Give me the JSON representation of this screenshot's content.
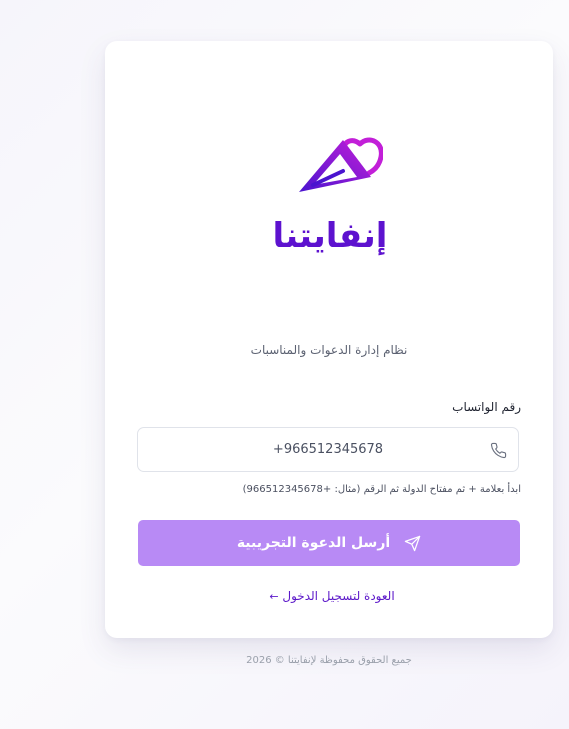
{
  "brand": {
    "logo_icon": "paper-plane-heart-icon",
    "name": "إنفايتنا",
    "primary_color": "#5d12cf",
    "accent_color": "#c026d3"
  },
  "subtitle": "نظام إدارة الدعوات والمناسبات",
  "phone": {
    "label": "رقم الواتساب",
    "value": "+966512345678",
    "icon": "phone-icon",
    "hint": "ابدأ بعلامة + ثم مفتاح الدولة ثم الرقم (مثال: +966512345678)"
  },
  "submit": {
    "label": "أرسل الدعوة التجريبية",
    "icon": "send-icon",
    "color": "#b88af5"
  },
  "back_link": {
    "label": "العودة لتسجيل الدخول",
    "icon": "arrow-left-icon",
    "arrow": "←"
  },
  "footer": "جميع الحقوق محفوظة لإنفايتنا © 2026"
}
